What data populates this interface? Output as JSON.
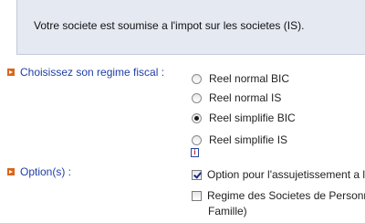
{
  "banner": {
    "text": "Votre societe est soumise a l'impot sur les societes (IS)."
  },
  "regime": {
    "label": "Choisissez son regime fiscal :",
    "options": [
      {
        "label": "Reel normal BIC",
        "selected": false
      },
      {
        "label": "Reel normal IS",
        "selected": false
      },
      {
        "label": "Reel simplifie BIC",
        "selected": true
      },
      {
        "label": "Reel simplifie IS",
        "selected": false
      }
    ],
    "info_icon": "i"
  },
  "options": {
    "label": "Option(s) :",
    "items": [
      {
        "label": "Option pour l'assujetissement a l'IS",
        "checked": true
      },
      {
        "label_line1": "Regime des Societes de Personnes",
        "label_line2": "Famille)",
        "checked": false
      }
    ]
  },
  "colors": {
    "accent": "#d9651b",
    "label": "#1f3ea8",
    "banner_bg": "#e4e9f2"
  }
}
